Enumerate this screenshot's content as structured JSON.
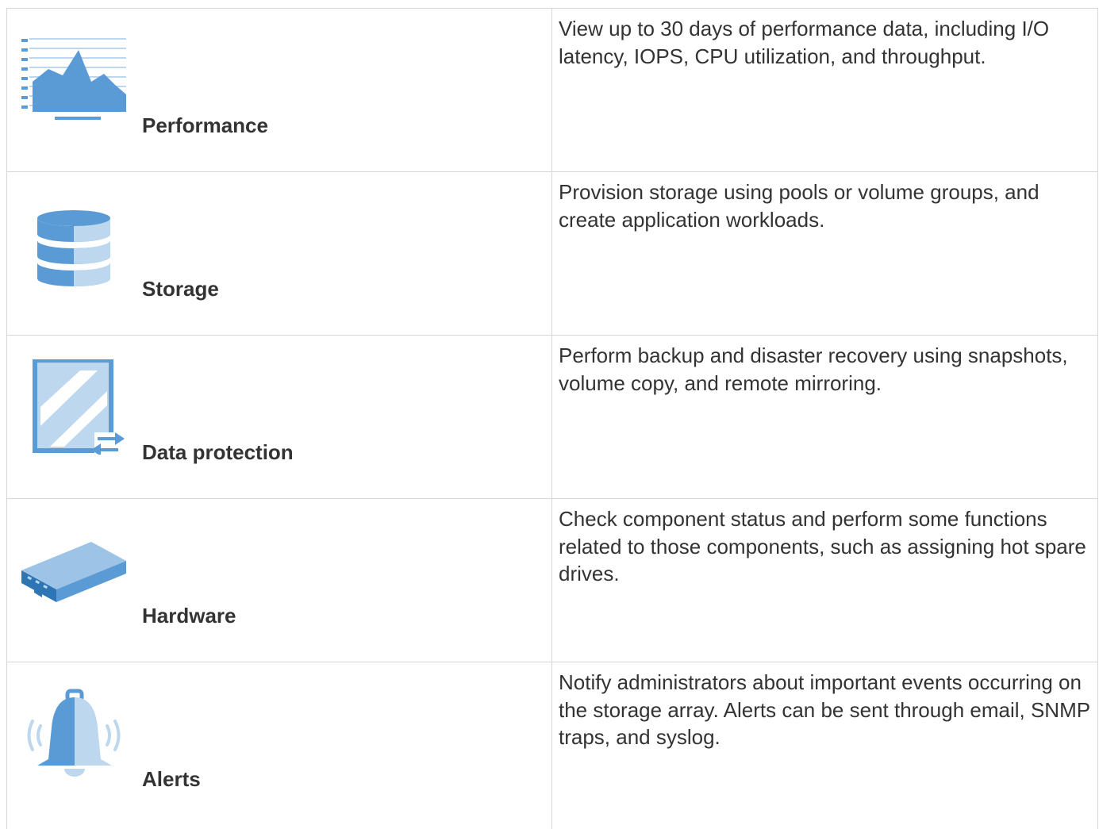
{
  "colors": {
    "icon_dark": "#5b9bd5",
    "icon_light": "#bdd7ee",
    "border": "#d6d6d6",
    "text": "#333333"
  },
  "features": [
    {
      "name": "Performance",
      "icon": "performance-chart-icon",
      "description": "View up to 30 days of performance data, including I/O latency, IOPS, CPU utilization, and throughput."
    },
    {
      "name": "Storage",
      "icon": "storage-database-icon",
      "description": "Provision storage using pools or volume groups, and create application workloads."
    },
    {
      "name": "Data protection",
      "icon": "data-protection-mirror-icon",
      "description": "Perform backup and disaster recovery using snapshots, volume copy, and remote mirroring."
    },
    {
      "name": "Hardware",
      "icon": "hardware-server-icon",
      "description": "Check component status and perform some functions related to those components, such as assigning hot spare drives."
    },
    {
      "name": "Alerts",
      "icon": "alert-bell-icon",
      "description": "Notify administrators about important events occurring on the storage array. Alerts can be sent through email, SNMP traps, and syslog."
    }
  ]
}
